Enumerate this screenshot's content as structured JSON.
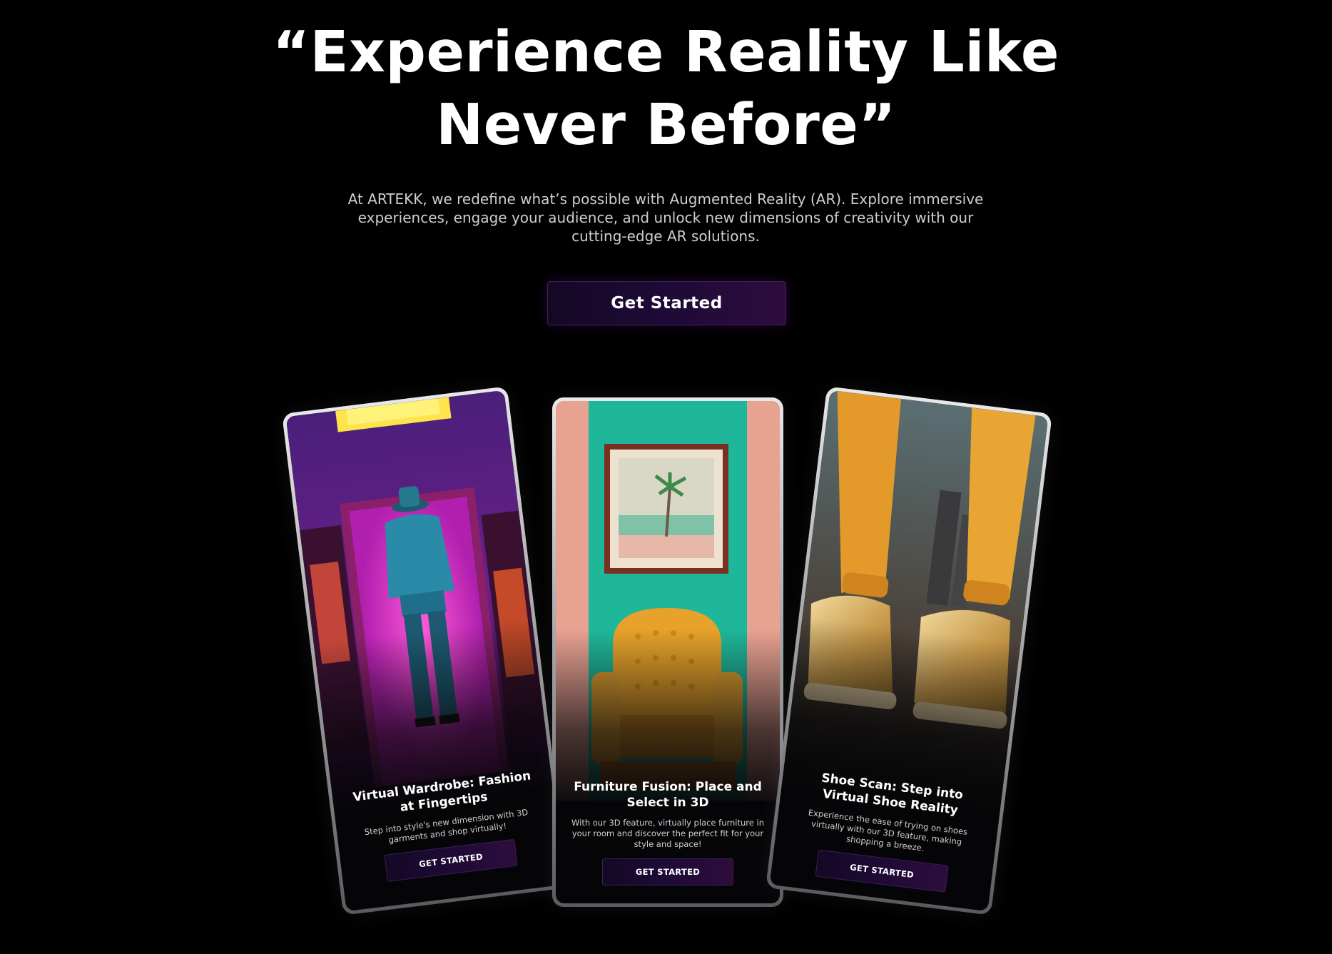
{
  "hero": {
    "title_line1": "“Experience Reality Like",
    "title_line2": "Never Before”",
    "subtitle": "At ARTEKK, we redefine what’s possible with Augmented Reality (AR). Explore immersive experiences, engage your audience, and unlock new dimensions of creativity with our cutting-edge AR solutions.",
    "cta_label": "Get Started"
  },
  "cards": [
    {
      "title": "Virtual Wardrobe: Fashion at Fingertips",
      "description": "Step into style's new dimension with 3D garments and shop virtually!",
      "button_label": "GET STARTED",
      "image_icon": "man-in-neon-doorway-image"
    },
    {
      "title": "Furniture Fusion: Place and Select in 3D",
      "description": "With our 3D feature, virtually place furniture in your room and discover the perfect fit for your style and space!",
      "button_label": "GET STARTED",
      "image_icon": "yellow-armchair-image"
    },
    {
      "title": "Shoe Scan: Step into Virtual Shoe Reality",
      "description": "Experience the ease of trying on shoes virtually with our 3D feature, making shopping a breeze.",
      "button_label": "GET STARTED",
      "image_icon": "gold-sneakers-image"
    }
  ],
  "colors": {
    "background": "#000000",
    "button_gradient_start": "#150826",
    "button_gradient_end": "#2e0c3d",
    "text_primary": "#ffffff",
    "text_secondary": "#cfcfcf"
  }
}
